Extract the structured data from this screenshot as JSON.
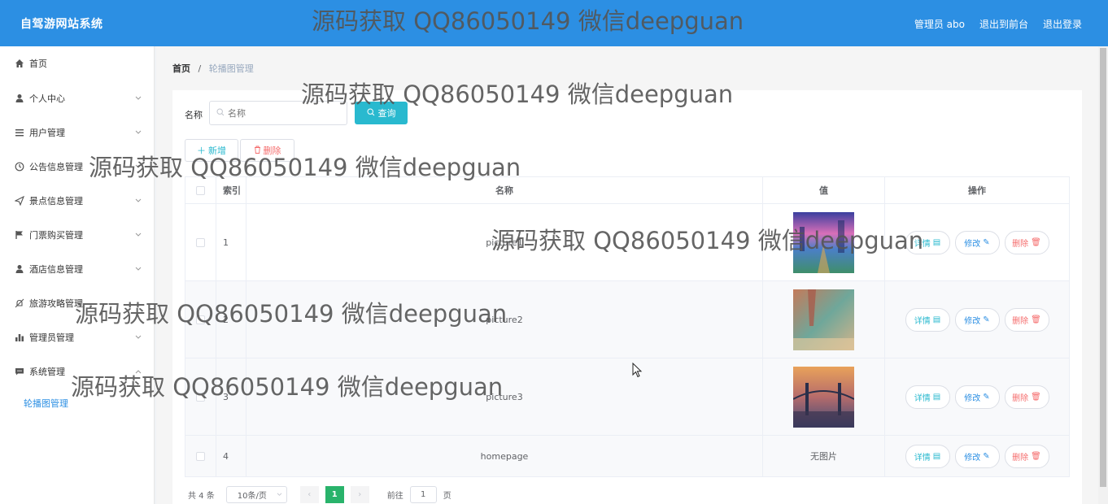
{
  "header": {
    "app_title": "自驾游网站系统",
    "admin_label": "管理员 abo",
    "goto_front": "退出到前台",
    "logout": "退出登录"
  },
  "sidebar": {
    "items": [
      {
        "label": "首页",
        "icon": "home-icon"
      },
      {
        "label": "个人中心",
        "icon": "user-icon"
      },
      {
        "label": "用户管理",
        "icon": "list-icon"
      },
      {
        "label": "公告信息管理",
        "icon": "clock-icon"
      },
      {
        "label": "景点信息管理",
        "icon": "send-icon"
      },
      {
        "label": "门票购买管理",
        "icon": "flag-icon"
      },
      {
        "label": "酒店信息管理",
        "icon": "user-icon"
      },
      {
        "label": "旅游攻略管理",
        "icon": "bell-off-icon"
      },
      {
        "label": "管理员管理",
        "icon": "bar-chart-icon"
      },
      {
        "label": "系统管理",
        "icon": "chat-icon"
      }
    ],
    "active_sub": "轮播图管理"
  },
  "breadcrumb": {
    "home": "首页",
    "sep": "/",
    "current": "轮播图管理"
  },
  "search": {
    "label": "名称",
    "placeholder": "名称",
    "button": "查询"
  },
  "actions": {
    "add": "新增",
    "delete": "删除"
  },
  "table": {
    "headers": {
      "index": "索引",
      "name": "名称",
      "value": "值",
      "ops": "操作"
    },
    "rows": [
      {
        "index": "1",
        "name": "picture1",
        "value_type": "image",
        "image": "city-sunset"
      },
      {
        "index": "2",
        "name": "picture2",
        "value_type": "image",
        "image": "beach-hand"
      },
      {
        "index": "3",
        "name": "picture3",
        "value_type": "image",
        "image": "bridge-city"
      },
      {
        "index": "4",
        "name": "homepage",
        "value_type": "text",
        "value_text": "无图片"
      }
    ],
    "op_labels": {
      "detail": "详情",
      "edit": "修改",
      "delete": "删除"
    }
  },
  "pagination": {
    "total": "共 4 条",
    "page_size": "10条/页",
    "current_page": "1",
    "goto_label": "前往",
    "goto_value": "1",
    "page_unit": "页"
  },
  "watermark": "源码获取 QQ86050149 微信deepguan",
  "colors": {
    "topbar": "#2c8fe3",
    "search_btn": "#29b9cf",
    "active_page": "#29b36b",
    "danger": "#f56c6c"
  }
}
